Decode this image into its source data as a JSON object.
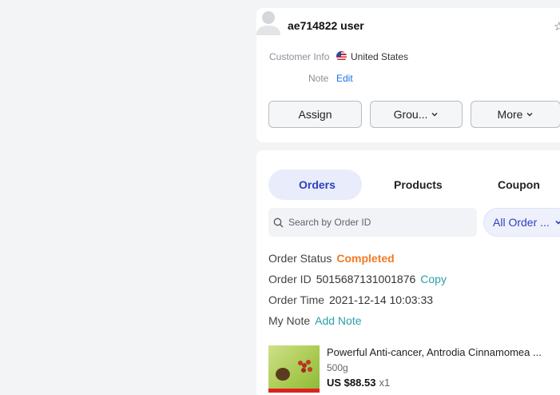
{
  "customer": {
    "username": "ae714822 user",
    "info_label": "Customer Info",
    "country": "United States",
    "note_label": "Note",
    "note_action": "Edit"
  },
  "actions": {
    "assign": "Assign",
    "group": "Grou...",
    "more": "More"
  },
  "tabs": [
    {
      "label": "Orders",
      "active": true
    },
    {
      "label": "Products",
      "active": false
    },
    {
      "label": "Coupon",
      "active": false
    }
  ],
  "search": {
    "placeholder": "Search by Order ID"
  },
  "filter": {
    "value": "All Order ..."
  },
  "order": {
    "status_label": "Order Status",
    "status_value": "Completed",
    "id_label": "Order ID",
    "id_value": "5015687131001876",
    "copy_label": "Copy",
    "time_label": "Order Time",
    "time_value": "2021-12-14 10:03:33",
    "note_label": "My Note",
    "note_action": "Add Note"
  },
  "product": {
    "name": "Powerful Anti-cancer, Antrodia Cinnamomea ...",
    "weight": "500g",
    "price": "US $88.53",
    "qty": "x1"
  },
  "colors": {
    "accent": "#2f3fbd",
    "status": "#f27a24",
    "link": "#2aa0a8"
  }
}
